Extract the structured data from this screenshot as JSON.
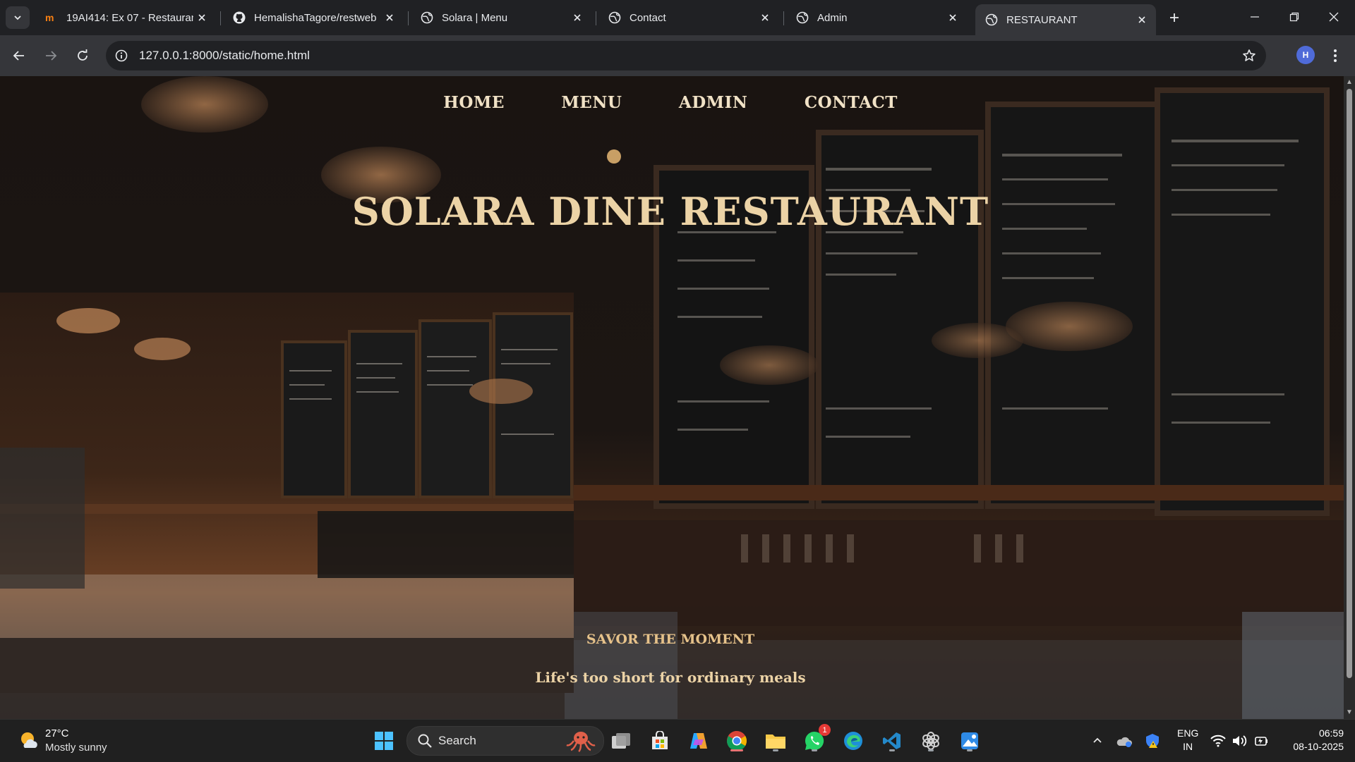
{
  "browser": {
    "tabs": [
      {
        "title": "19AI414: Ex 07 - Restauran",
        "favicon": "moodle-icon",
        "active": false
      },
      {
        "title": "HemalishaTagore/restweb",
        "favicon": "github-icon",
        "active": false
      },
      {
        "title": "Solara | Menu",
        "favicon": "globe-icon",
        "active": false
      },
      {
        "title": "Contact",
        "favicon": "globe-icon",
        "active": false
      },
      {
        "title": "Admin",
        "favicon": "globe-icon",
        "active": false
      },
      {
        "title": "RESTAURANT",
        "favicon": "globe-icon",
        "active": true
      }
    ],
    "url": "127.0.0.1:8000/static/home.html",
    "profile_initial": "H"
  },
  "page": {
    "nav": [
      "HOME",
      "MENU",
      "ADMIN",
      "CONTACT"
    ],
    "title": "SOLARA DINE RESTAURANT",
    "tagline": "SAVOR THE MOMENT",
    "subtagline": "Life's too short for ordinary meals"
  },
  "taskbar": {
    "weather": {
      "temp": "27°C",
      "desc": "Mostly sunny"
    },
    "search_label": "Search",
    "whatsapp_badge": "1",
    "lang_line1": "ENG",
    "lang_line2": "IN",
    "time": "06:59",
    "date": "08-10-2025"
  },
  "colors": {
    "heading_gold": "#ecd3a6",
    "tagline_gold": "#e6c28a",
    "browser_dark": "#202124"
  }
}
